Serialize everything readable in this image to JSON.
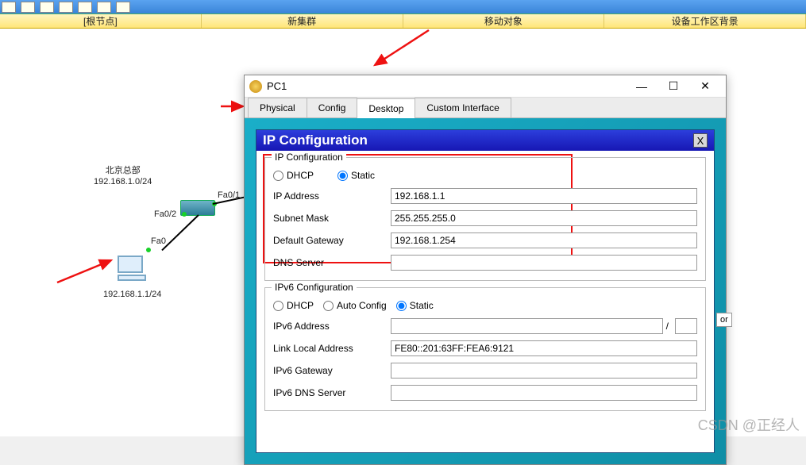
{
  "menubar": {
    "root_node": "[根节点]",
    "new_cluster": "新集群",
    "move_object": "移动对象",
    "device_work_bg": "设备工作区背景"
  },
  "topology": {
    "site_name": "北京总部",
    "site_net": "192.168.1.0/24",
    "if_fa01": "Fa0/1",
    "if_fa02": "Fa0/2",
    "if_fa0": "Fa0",
    "pc_addr": "192.168.1.1/24"
  },
  "dialog": {
    "title": "PC1",
    "tabs": {
      "physical": "Physical",
      "config": "Config",
      "desktop": "Desktop",
      "custom": "Custom Interface"
    },
    "panel_title": "IP Configuration",
    "close_x": "X",
    "group_ip": "IP Configuration",
    "radio_dhcp": "DHCP",
    "radio_static": "Static",
    "ip_label": "IP Address",
    "ip_val": "192.168.1.1",
    "mask_label": "Subnet Mask",
    "mask_val": "255.255.255.0",
    "gw_label": "Default Gateway",
    "gw_val": "192.168.1.254",
    "dns_label": "DNS Server",
    "dns_val": "",
    "group_ipv6": "IPv6 Configuration",
    "radio_auto": "Auto Config",
    "ipv6_addr_label": "IPv6 Address",
    "ipv6_addr_val": "",
    "ipv6_prefix": "",
    "ll_label": "Link Local Address",
    "ll_val": "FE80::201:63FF:FEA6:9121",
    "ipv6_gw_label": "IPv6 Gateway",
    "ipv6_gw_val": "",
    "ipv6_dns_label": "IPv6 DNS Server",
    "ipv6_dns_val": ""
  },
  "side_indicator": "or",
  "watermark": "CSDN @正经人"
}
